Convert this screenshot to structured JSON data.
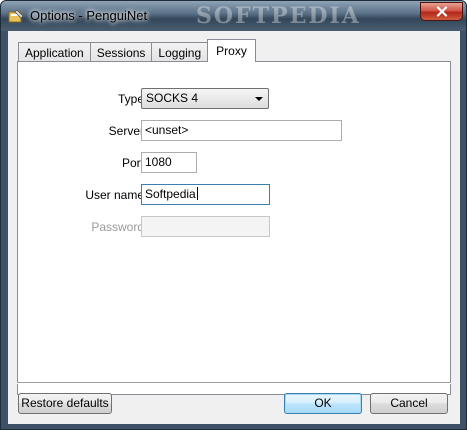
{
  "window": {
    "title": "Options - PenguiNet",
    "watermark": "SOFTPEDIA"
  },
  "tabs": [
    {
      "label": "Application",
      "active": false
    },
    {
      "label": "Sessions",
      "active": false
    },
    {
      "label": "Logging",
      "active": false
    },
    {
      "label": "Proxy",
      "active": true
    }
  ],
  "proxy": {
    "type_label": "Type",
    "type_value": "SOCKS 4",
    "server_label": "Server",
    "server_value": "<unset>",
    "port_label": "Port",
    "port_value": "1080",
    "username_label": "User name",
    "username_value": "Softpedia",
    "password_label": "Password",
    "password_value": ""
  },
  "buttons": {
    "restore_defaults": "Restore defaults",
    "ok": "OK",
    "cancel": "Cancel"
  },
  "colors": {
    "close_button": "#c4392b",
    "default_button_border": "#3c7fb1"
  }
}
